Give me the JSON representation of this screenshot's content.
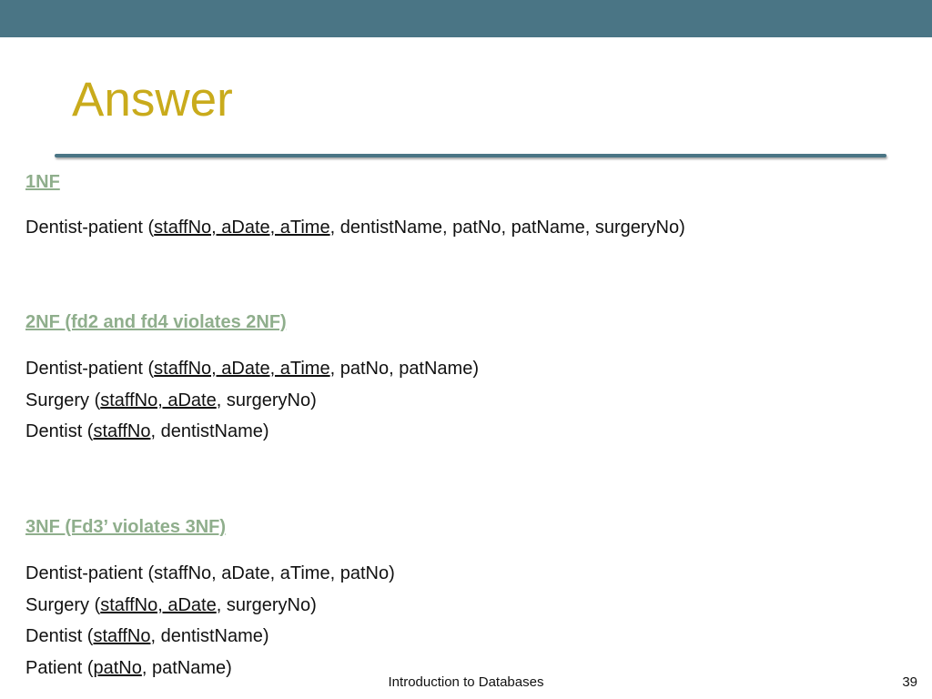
{
  "slide": {
    "title": "Answer",
    "footer": "Introduction to Databases",
    "page_number": "39",
    "colors": {
      "top_bar": "#4a7585",
      "title": "#c9ab1c",
      "heading": "#8fae8c",
      "rule": "#4a7585"
    }
  },
  "sections": {
    "nf1": {
      "heading": "1NF",
      "lines": [
        {
          "pre": "Dentist-patient (",
          "key": "staffNo, aDate, aTime",
          "post": ", dentistName, patNo, patName, surgeryNo)"
        }
      ]
    },
    "nf2": {
      "heading": "2NF (fd2 and fd4 violates 2NF)",
      "lines": [
        {
          "pre": "Dentist-patient (",
          "key": "staffNo, aDate, aTime",
          "post": ", patNo, patName)"
        },
        {
          "pre": "Surgery (",
          "key": "staffNo, aDate",
          "post": ", surgeryNo)"
        },
        {
          "pre": "Dentist (",
          "key": "staffNo",
          "post": ", dentistName)"
        }
      ]
    },
    "nf3": {
      "heading": "3NF (Fd3’ violates 3NF)",
      "lines": [
        {
          "pre": "Dentist-patient (staffNo, aDate, aTime, patNo)",
          "key": "",
          "post": ""
        },
        {
          "pre": "Surgery (",
          "key": "staffNo, aDate",
          "post": ", surgeryNo)"
        },
        {
          "pre": "Dentist (",
          "key": "staffNo",
          "post": ", dentistName)"
        },
        {
          "pre": "Patient (",
          "key": "patNo",
          "post": ", patName)"
        }
      ]
    }
  }
}
